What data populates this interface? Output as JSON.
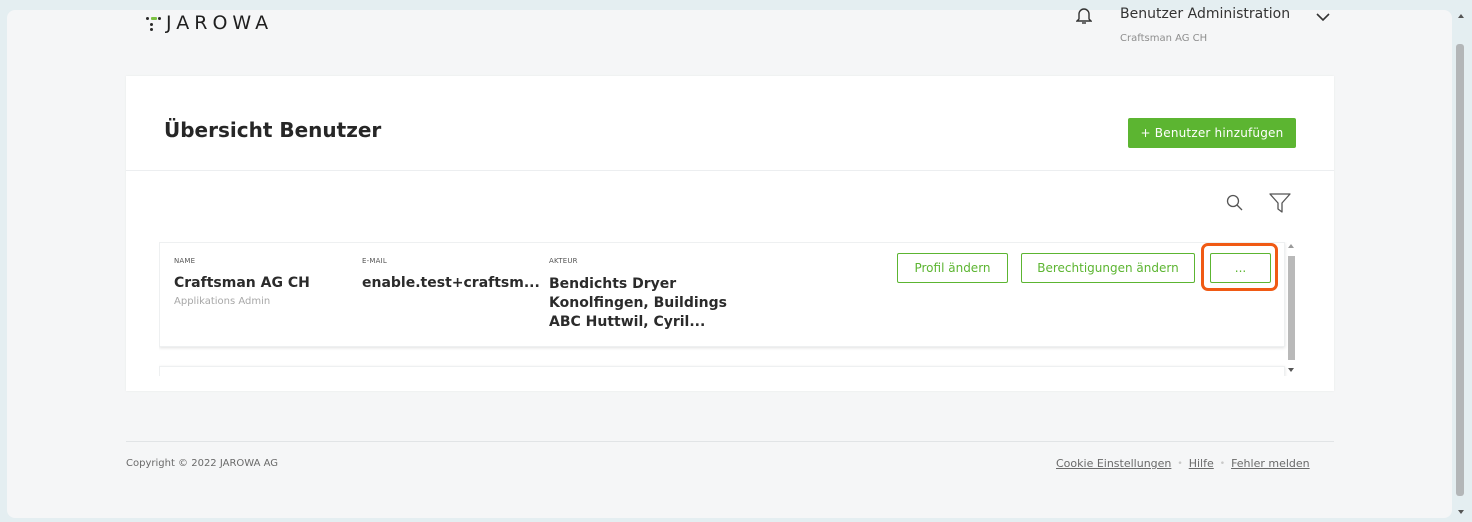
{
  "header": {
    "logo_text": "JAROWA",
    "user_name": "Benutzer Administration",
    "company": "Craftsman AG CH",
    "icons": [
      "bell-icon",
      "chevron-down-icon"
    ]
  },
  "overview": {
    "title": "Übersicht Benutzer",
    "add_button": "+ Benutzer hinzufügen",
    "icons": [
      "search-icon",
      "filter-icon"
    ]
  },
  "table": {
    "columns": [
      "NAME",
      "E-MAIL",
      "AKTEUR"
    ],
    "rows": [
      {
        "name": "Craftsman AG CH",
        "role": "Applikations Admin",
        "email": "enable.test+craftsm...",
        "akteur_lines": [
          "Bendichts Dryer",
          "Konolfingen, Buildings",
          "ABC Huttwil, Cyril..."
        ],
        "actions": {
          "profile": "Profil ändern",
          "permissions": "Berechtigungen ändern",
          "more": "..."
        }
      }
    ]
  },
  "footer": {
    "copyright": "Copyright © 2022 JAROWA AG",
    "links": [
      "Cookie Einstellungen",
      "Hilfe",
      "Fehler melden"
    ],
    "separator": "•"
  },
  "colors": {
    "brand_green": "#5cb531",
    "highlight_orange": "#f05a14"
  }
}
